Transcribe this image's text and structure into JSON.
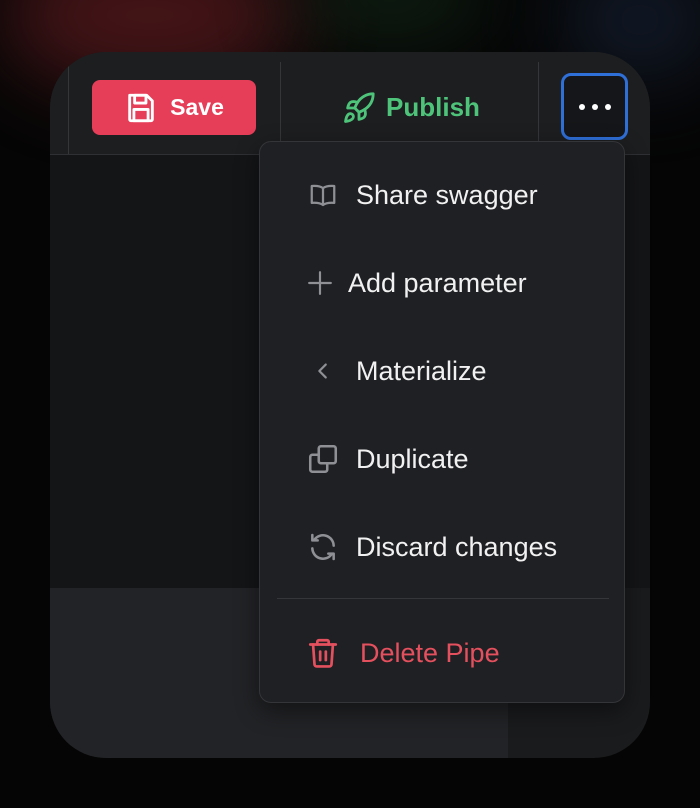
{
  "toolbar": {
    "save_label": "Save",
    "publish_label": "Publish"
  },
  "menu": {
    "items": [
      {
        "label": "Share swagger",
        "icon": "book-icon"
      },
      {
        "label": "Add parameter",
        "icon": "plus-icon"
      },
      {
        "label": "Materialize",
        "icon": "chevron-left-icon"
      },
      {
        "label": "Duplicate",
        "icon": "copy-icon"
      },
      {
        "label": "Discard changes",
        "icon": "refresh-icon"
      }
    ],
    "danger_item": {
      "label": "Delete Pipe",
      "icon": "trash-icon"
    }
  },
  "colors": {
    "save": "#e63e59",
    "publish": "#4ec47a",
    "focus_ring": "#2f6fd8",
    "danger": "#e5505e"
  }
}
